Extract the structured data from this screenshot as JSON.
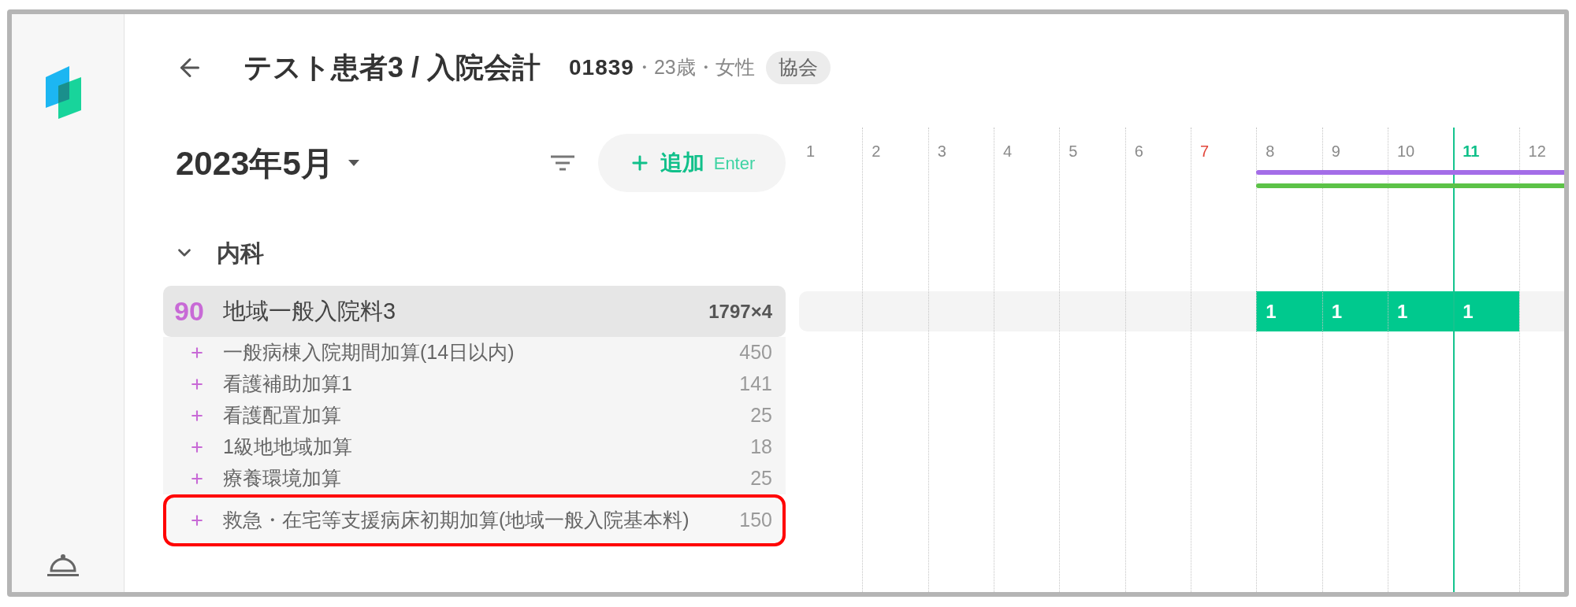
{
  "header": {
    "title": "テスト患者3 / 入院会計",
    "patient_id": "01839",
    "details": "・23歳・女性",
    "badge": "協会"
  },
  "month": "2023年5月",
  "add_button": {
    "label": "追加",
    "shortcut": "Enter"
  },
  "sections": [
    {
      "title": "内科",
      "expanded": true,
      "items": [
        {
          "points": "90",
          "name": "地域一般入院料3",
          "amount": "1797×4",
          "children": [
            {
              "name": "一般病棟入院期間加算(14日以内)",
              "amount": "450",
              "highlighted": false
            },
            {
              "name": "看護補助加算1",
              "amount": "141",
              "highlighted": false
            },
            {
              "name": "看護配置加算",
              "amount": "25",
              "highlighted": false
            },
            {
              "name": "1級地地域加算",
              "amount": "18",
              "highlighted": false
            },
            {
              "name": "療養環境加算",
              "amount": "25",
              "highlighted": false
            },
            {
              "name": "救急・在宅等支援病床初期加算(地域一般入院基本料)",
              "amount": "150",
              "highlighted": true
            }
          ]
        }
      ]
    }
  ],
  "calendar": {
    "days": [
      {
        "label": "1",
        "kind": "weekday"
      },
      {
        "label": "2",
        "kind": "weekday"
      },
      {
        "label": "3",
        "kind": "weekday"
      },
      {
        "label": "4",
        "kind": "weekday"
      },
      {
        "label": "5",
        "kind": "weekday"
      },
      {
        "label": "6",
        "kind": "weekday"
      },
      {
        "label": "7",
        "kind": "sunday"
      },
      {
        "label": "8",
        "kind": "weekday"
      },
      {
        "label": "9",
        "kind": "weekday"
      },
      {
        "label": "10",
        "kind": "weekday"
      },
      {
        "label": "11",
        "kind": "today"
      },
      {
        "label": "12",
        "kind": "weekday"
      }
    ],
    "periods": [
      {
        "color": "#a46de8"
      },
      {
        "color": "#5cc247"
      }
    ],
    "rows": [
      {
        "cells": [
          {
            "filled": false
          },
          {
            "filled": false
          },
          {
            "filled": false
          },
          {
            "filled": false
          },
          {
            "filled": false
          },
          {
            "filled": false
          },
          {
            "filled": false
          },
          {
            "filled": true,
            "count": "1"
          },
          {
            "filled": true,
            "count": "1"
          },
          {
            "filled": true,
            "count": "1"
          },
          {
            "filled": true,
            "count": "1"
          },
          {
            "filled": false
          }
        ]
      }
    ]
  }
}
